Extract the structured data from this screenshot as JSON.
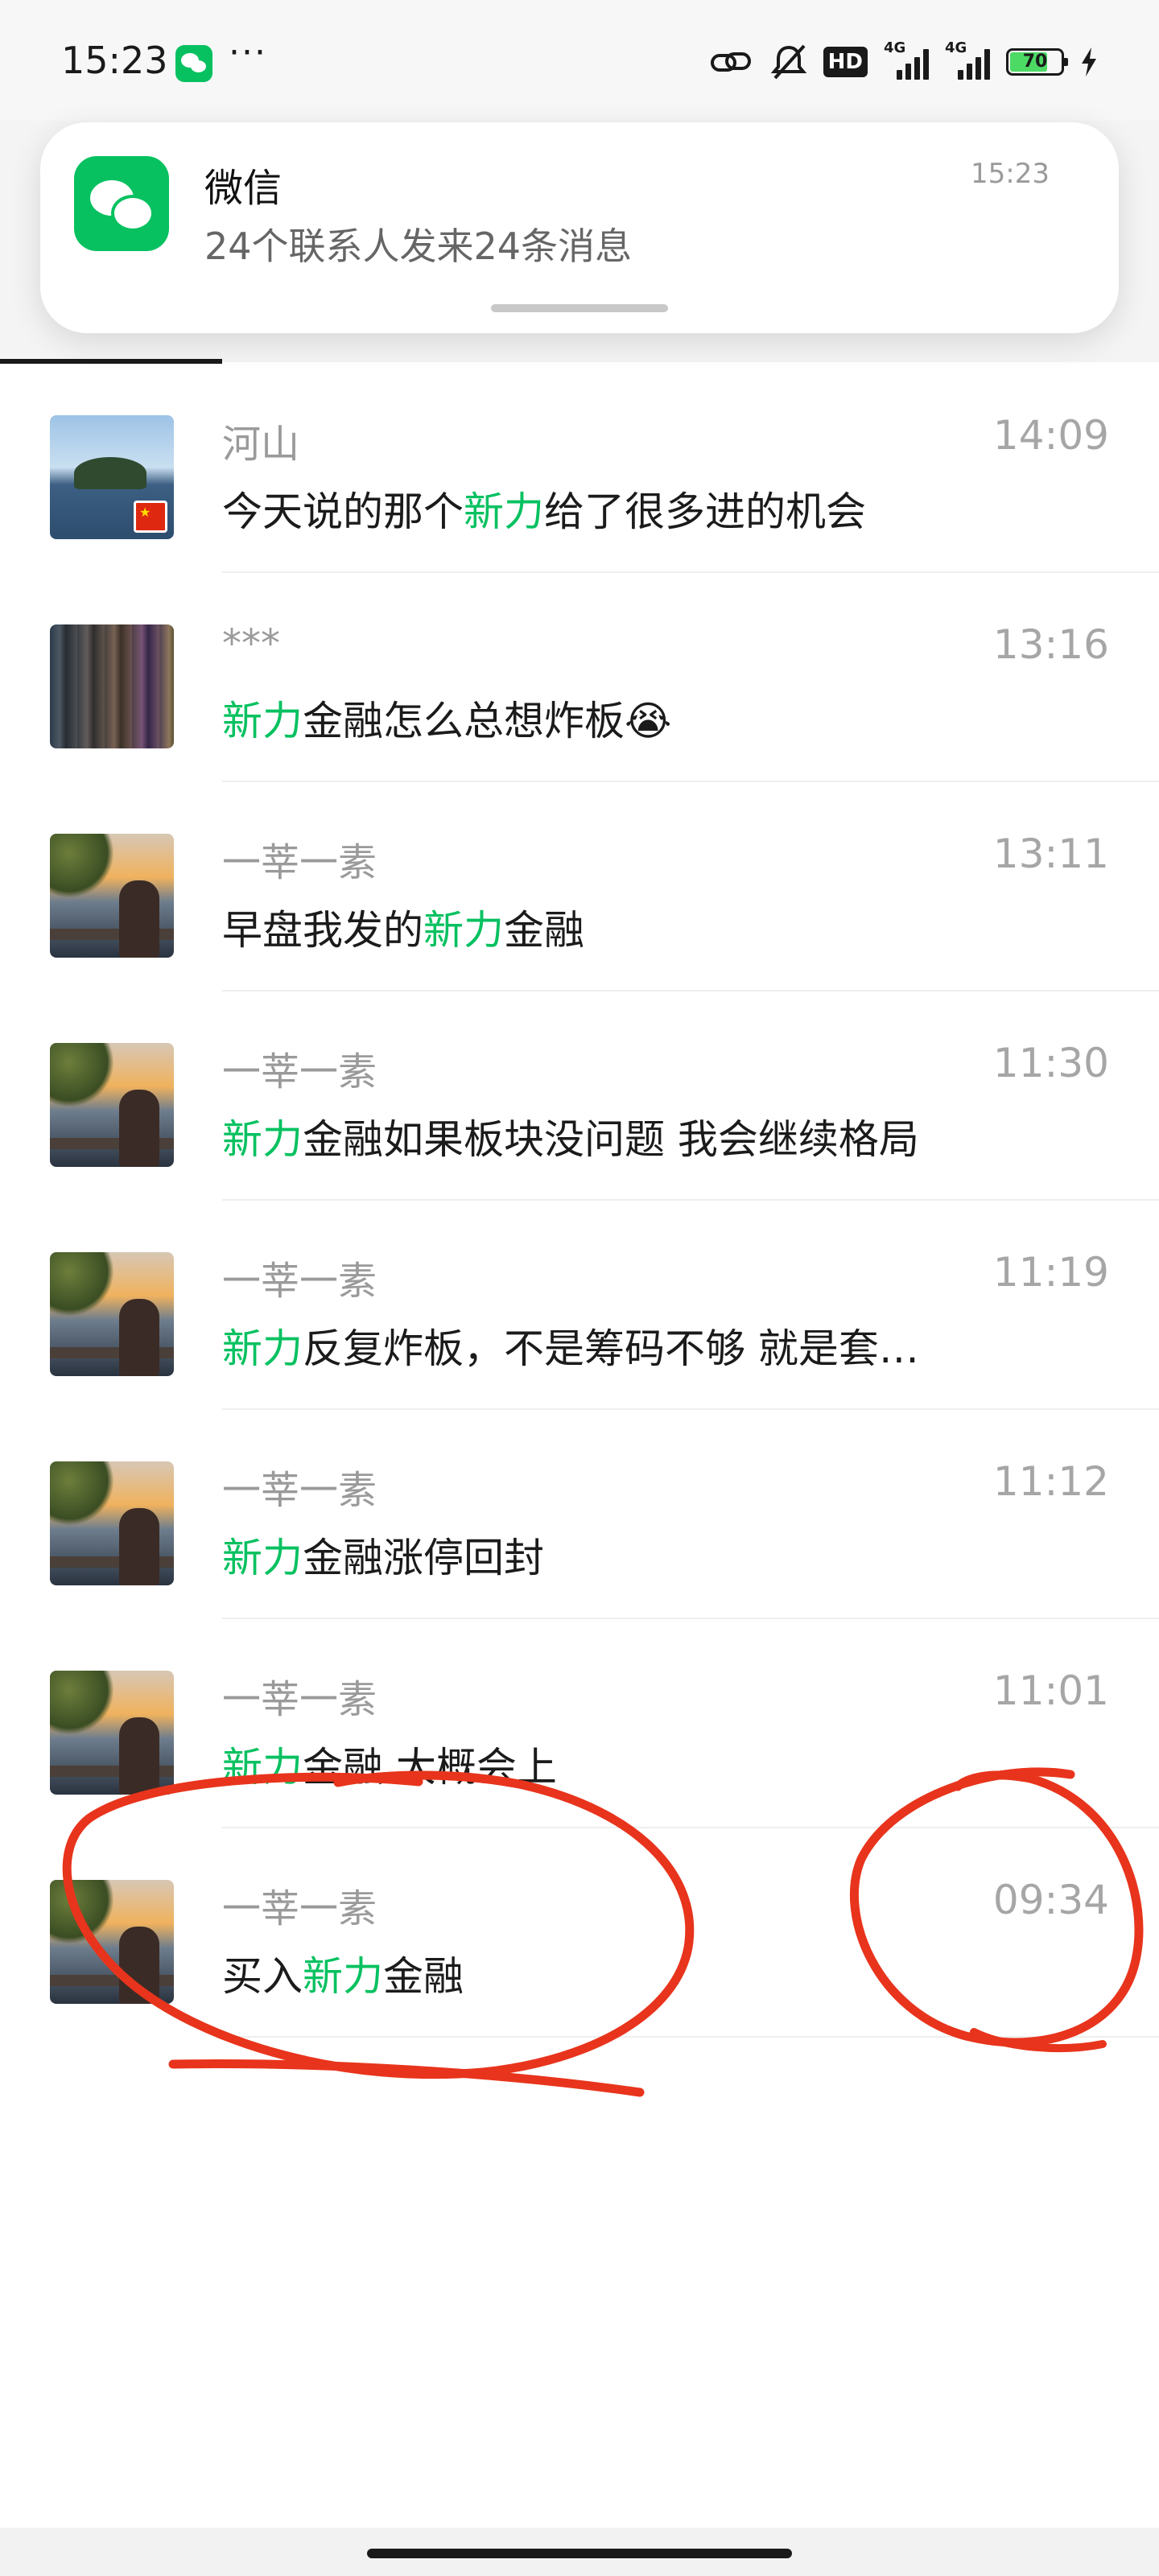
{
  "status_bar": {
    "time": "15:23",
    "more": "···",
    "hd": "HD",
    "signal1": "4G",
    "signal2": "4G",
    "battery": "70"
  },
  "notification": {
    "app_name": "微信",
    "body": "24个联系人发来24条消息",
    "time": "15:23"
  },
  "messages": [
    {
      "sender": "河山",
      "time": "14:09",
      "pre": "今天说的那个",
      "highlight": "新力",
      "post": "给了很多进的机会",
      "avatar": "lake-island-avatar"
    },
    {
      "sender": "***",
      "time": "13:16",
      "pre": "",
      "highlight": "新力",
      "post": "金融怎么总想炸板😭",
      "avatar": "building-avatar"
    },
    {
      "sender": "一莘一素",
      "time": "13:11",
      "pre": "早盘我发的",
      "highlight": "新力",
      "post": "金融",
      "avatar": "sunset-person-avatar"
    },
    {
      "sender": "一莘一素",
      "time": "11:30",
      "pre": "",
      "highlight": "新力",
      "post": "金融如果板块没问题 我会继续格局",
      "avatar": "sunset-person-avatar"
    },
    {
      "sender": "一莘一素",
      "time": "11:19",
      "pre": "",
      "highlight": "新力",
      "post": "反复炸板，不是筹码不够 就是套…",
      "avatar": "sunset-person-avatar"
    },
    {
      "sender": "一莘一素",
      "time": "11:12",
      "pre": "",
      "highlight": "新力",
      "post": "金融涨停回封",
      "avatar": "sunset-person-avatar"
    },
    {
      "sender": "一莘一素",
      "time": "11:01",
      "pre": "",
      "highlight": "新力",
      "post": "金融 大概会上",
      "avatar": "sunset-person-avatar"
    },
    {
      "sender": "一莘一素",
      "time": "09:34",
      "pre": "买入",
      "highlight": "新力",
      "post": "金融",
      "avatar": "sunset-person-avatar"
    }
  ],
  "colors": {
    "highlight": "#07c160",
    "annotation": "#e8341c"
  }
}
